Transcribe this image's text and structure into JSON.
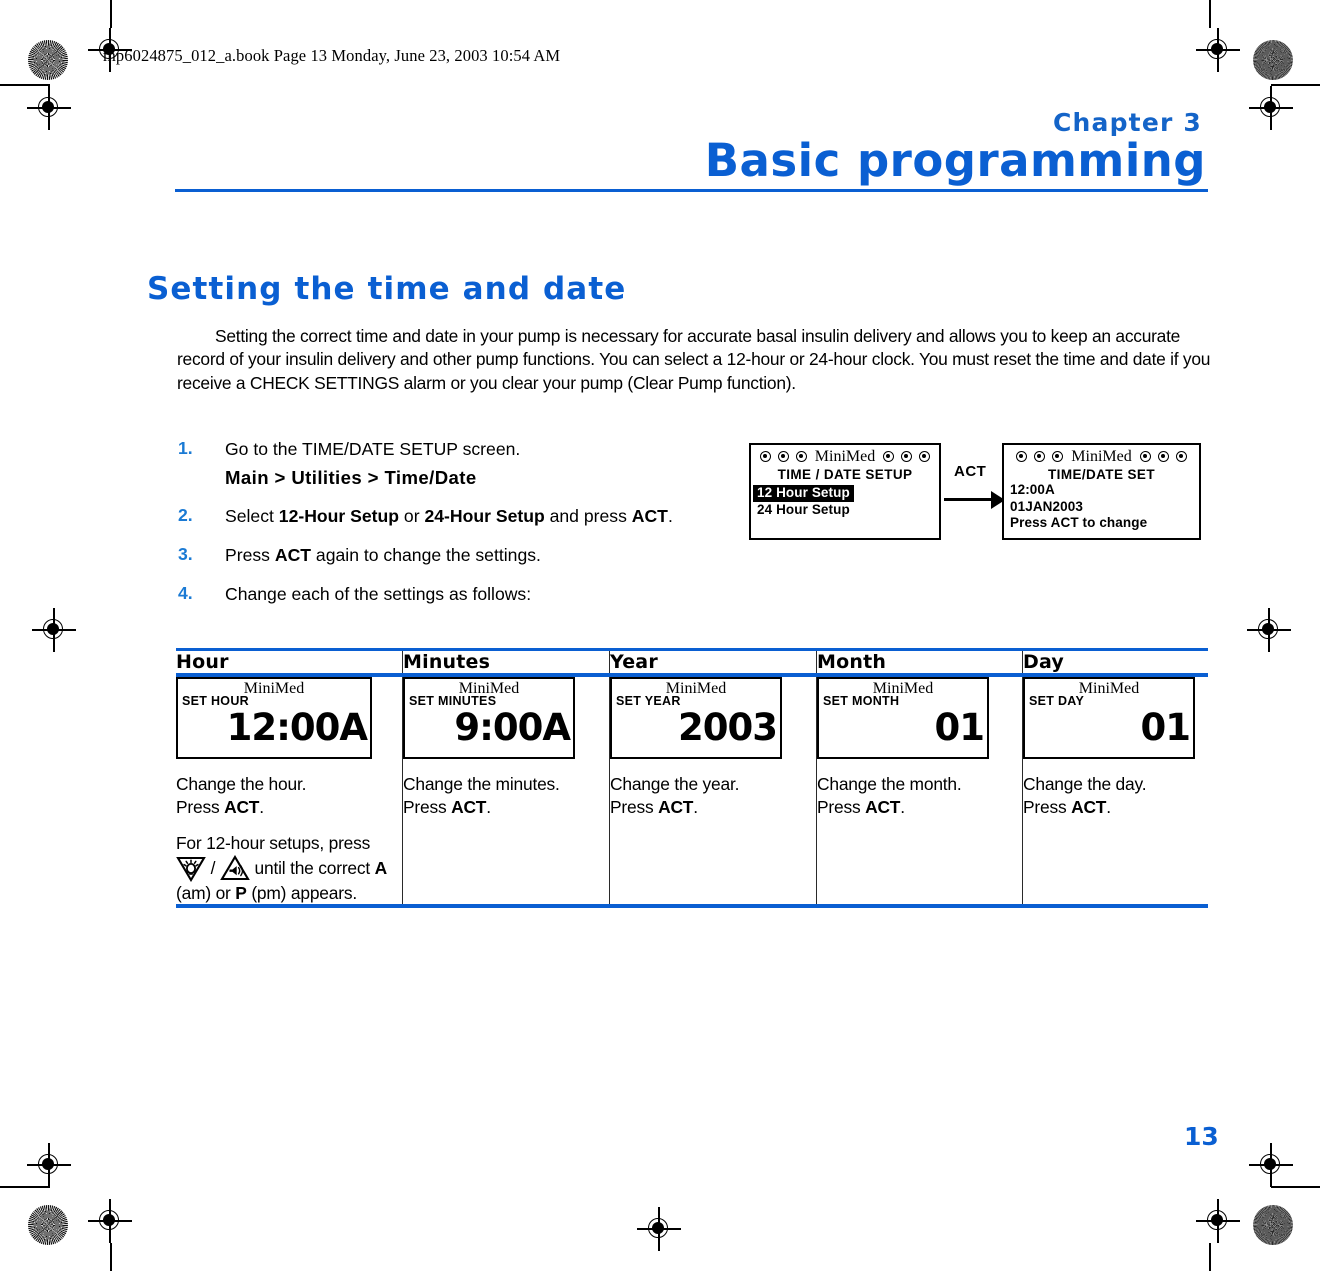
{
  "file_header": "mp6024875_012_a.book  Page 13  Monday, June 23, 2003  10:54 AM",
  "chapter": {
    "label": "Chapter 3",
    "title": "Basic programming"
  },
  "section": {
    "title": "Setting the time and date",
    "paragraph": "Setting the correct time and date in your pump is necessary for accurate basal insulin delivery and allows you to keep an accurate record of your insulin delivery and other pump functions. You can select a 12-hour or 24-hour clock. You must reset the time and date if you receive a CHECK SETTINGS alarm or you clear your pump (Clear Pump function)."
  },
  "steps": [
    {
      "num": "1.",
      "text_before": "Go to the TIME/DATE SETUP screen.",
      "path": "Main > Utilities > Time/Date"
    },
    {
      "num": "2.",
      "part1": "Select ",
      "bold1": "12-Hour Setup",
      "part2": " or ",
      "bold2": "24-Hour Setup",
      "part3": " and press ",
      "bold3": "ACT",
      "part4": "."
    },
    {
      "num": "3.",
      "part1": "Press ",
      "bold1": "ACT",
      "part2": " again to change the settings."
    },
    {
      "num": "4.",
      "part1": "Change each of the settings as follows:"
    }
  ],
  "flow": {
    "act_label": "ACT",
    "brand": "MiniMed",
    "screen_setup": {
      "heading": "TIME / DATE SETUP",
      "option_selected": "12 Hour Setup",
      "option_other": "24 Hour Setup"
    },
    "screen_confirm": {
      "heading": "TIME/DATE SET",
      "line1": "12:00A",
      "line2": "01JAN2003",
      "line3": "Press ACT to change"
    }
  },
  "table": {
    "headers": [
      "Hour",
      "Minutes",
      "Year",
      "Month",
      "Day"
    ],
    "columns": [
      {
        "screen": {
          "brand": "MiniMed",
          "label": "SET HOUR",
          "value": "12:00A"
        },
        "caption_lines": [
          {
            "text1": "Change the hour.",
            "text2": "Press ",
            "bold": "ACT",
            "text3": "."
          }
        ],
        "extra": {
          "pre": "For 12-hour setups, press ",
          "mid": " / ",
          "post": " until the correct ",
          "bold_a": "A",
          "post2": " (am) or ",
          "bold_p": "P",
          "post3": " (pm) appears."
        }
      },
      {
        "screen": {
          "brand": "MiniMed",
          "label": "SET MINUTES",
          "value": "9:00A"
        },
        "caption_lines": [
          {
            "text1": "Change the minutes.",
            "text2": "Press ",
            "bold": "ACT",
            "text3": "."
          }
        ]
      },
      {
        "screen": {
          "brand": "MiniMed",
          "label": "SET YEAR",
          "value": "2003"
        },
        "caption_lines": [
          {
            "text1": "Change the year.",
            "text2": "Press ",
            "bold": "ACT",
            "text3": "."
          }
        ]
      },
      {
        "screen": {
          "brand": "MiniMed",
          "label": "SET MONTH",
          "value": "01"
        },
        "caption_lines": [
          {
            "text1": "Change the month.",
            "text2": "Press ",
            "bold": "ACT",
            "text3": "."
          }
        ]
      },
      {
        "screen": {
          "brand": "MiniMed",
          "label": "SET DAY",
          "value": "01"
        },
        "caption_lines": [
          {
            "text1": "Change the day.",
            "text2": "Press ",
            "bold": "ACT",
            "text3": "."
          }
        ]
      }
    ]
  },
  "page_number": "13",
  "colors": {
    "accent_blue": "#0a5fd2",
    "step_number_blue": "#1a7ad4"
  }
}
